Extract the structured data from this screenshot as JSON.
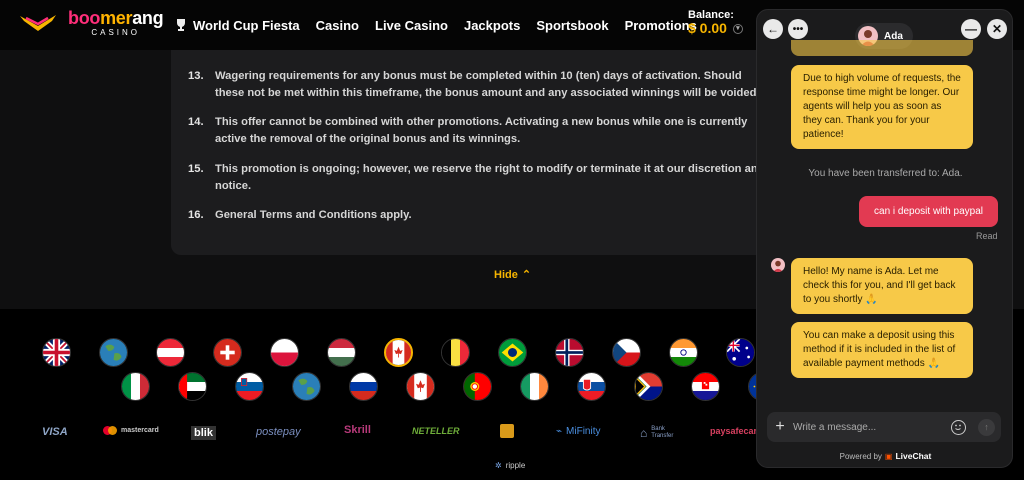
{
  "header": {
    "logo_word_parts": [
      "boo",
      "mer",
      "ang"
    ],
    "logo_sub": "CASINO",
    "nav": [
      "World Cup Fiesta",
      "Casino",
      "Live Casino",
      "Jackpots",
      "Sportsbook",
      "Promotions"
    ],
    "balance_label": "Balance:",
    "balance_value": "$ 0.00"
  },
  "terms": {
    "items": [
      {
        "num": "13.",
        "text": "Wagering requirements for any bonus must be completed within 10 (ten) days of activation. Should these not be met within this timeframe, the bonus amount and any associated winnings will be voided."
      },
      {
        "num": "14.",
        "text": "This offer cannot be combined with other promotions. Activating a new bonus while one is currently active the removal of the original bonus and its winnings."
      },
      {
        "num": "15.",
        "text": "This promotion is ongoing; however, we reserve the right to modify or terminate it at our discretion and notice."
      },
      {
        "num": "16.",
        "text": "General Terms and Conditions apply."
      }
    ],
    "hide_label": "Hide"
  },
  "footer": {
    "flags_row1": [
      "uk-flag",
      "globe-flag",
      "austria-flag",
      "switzerland-flag",
      "poland-flag",
      "hungary-flag",
      "canada-flag",
      "belgium-flag",
      "brazil-flag",
      "norway-flag",
      "czech-flag",
      "india-flag",
      "australia-flag"
    ],
    "flags_row2": [
      "italy-flag",
      "uae-flag",
      "slovenia-flag",
      "globe-flag",
      "russia-flag",
      "canada-flag",
      "portugal-flag",
      "ireland-flag",
      "slovakia-flag",
      "south-africa-flag",
      "croatia-flag",
      "eu-flag"
    ],
    "payments": [
      "VISA",
      "mastercard",
      "blik",
      "postepay",
      "Skrill",
      "NETELLER",
      "",
      "MiFinity",
      "Bank Transfer",
      "paysafecard"
    ],
    "payment_row2": "ripple"
  },
  "chat": {
    "agent_name": "Ada",
    "msg_wait": "Due to high volume of requests, the response time might be longer. Our agents will help you as soon as they can. Thank you for your patience!",
    "transfer_msg": "You have been transferred to: Ada.",
    "user_msg": "can i deposit with paypal",
    "read_label": "Read",
    "agent_msg1": "Hello! My name is Ada. Let me check this for you, and I'll get back to you shortly 🙏",
    "agent_msg2": "You can make a deposit using this method if it is included in the list of available payment methods 🙏",
    "input_placeholder": "Write a message...",
    "powered_by": "Powered by",
    "powered_brand": "LiveChat"
  }
}
